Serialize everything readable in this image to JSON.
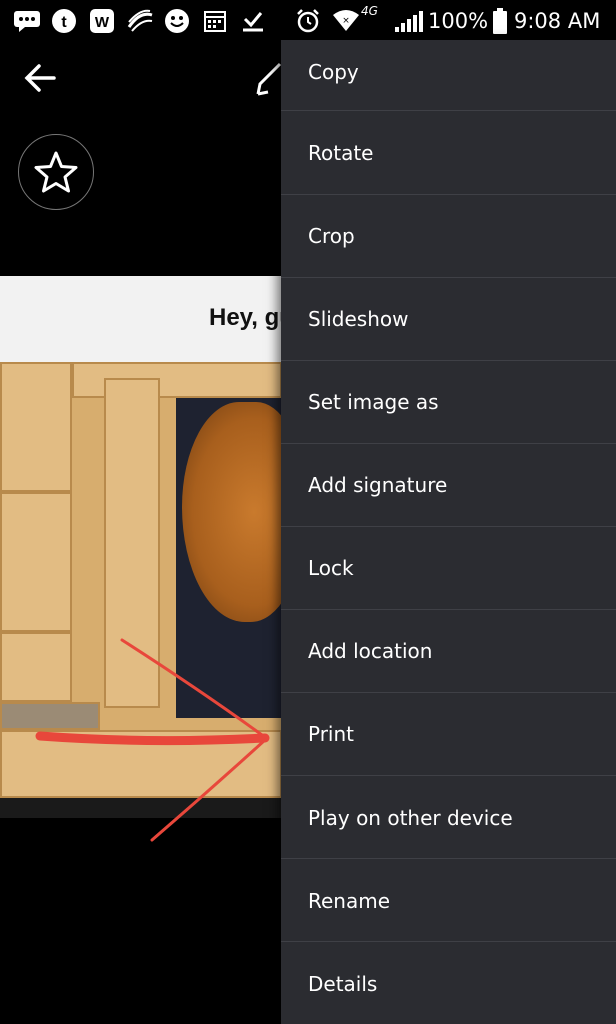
{
  "status_bar": {
    "battery_percent": "100%",
    "time": "9:08 AM",
    "network_label": "4G",
    "left_icons": [
      "chat-icon",
      "tumblr-icon",
      "w-app-icon",
      "swiftkey-icon",
      "smiley-icon",
      "calendar-icon",
      "download-icon"
    ],
    "right_icons": [
      "alarm-icon",
      "wifi-icon",
      "signal-icon",
      "battery-icon"
    ]
  },
  "viewer": {
    "photo_caption": "Hey, gu"
  },
  "menu": {
    "items": [
      {
        "label": "Copy"
      },
      {
        "label": "Rotate"
      },
      {
        "label": "Crop"
      },
      {
        "label": "Slideshow"
      },
      {
        "label": "Set image as"
      },
      {
        "label": "Add signature"
      },
      {
        "label": "Lock"
      },
      {
        "label": "Add location"
      },
      {
        "label": "Print"
      },
      {
        "label": "Play on other device"
      },
      {
        "label": "Rename"
      },
      {
        "label": "Details"
      }
    ]
  },
  "colors": {
    "menu_bg": "#2b2c31",
    "divider": "#3f4046",
    "annotation_arrow": "#e8473b"
  }
}
